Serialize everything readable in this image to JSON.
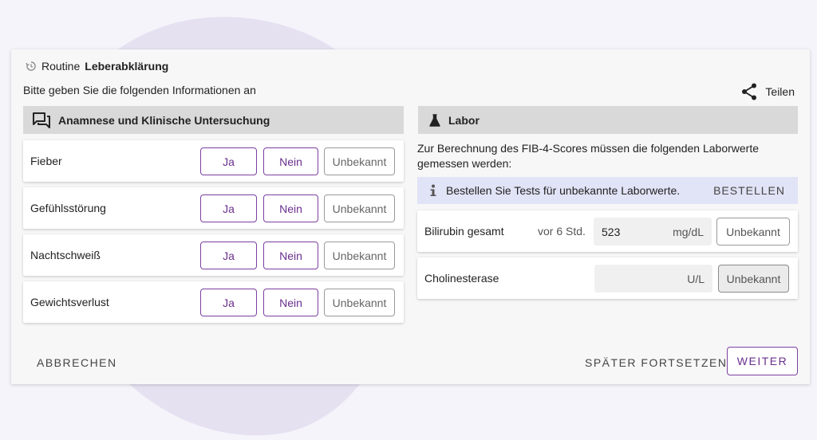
{
  "header": {
    "title_prefix": "Routine",
    "title_bold": "Leberabklärung",
    "subtitle": "Bitte geben Sie die folgenden Informationen an",
    "share_label": "Teilen"
  },
  "anamnese": {
    "heading": "Anamnese und Klinische Untersuchung",
    "questions": [
      {
        "label": "Fieber",
        "yes": "Ja",
        "no": "Nein",
        "unknown": "Unbekannt"
      },
      {
        "label": "Gefühlsstörung",
        "yes": "Ja",
        "no": "Nein",
        "unknown": "Unbekannt"
      },
      {
        "label": "Nachtschweiß",
        "yes": "Ja",
        "no": "Nein",
        "unknown": "Unbekannt"
      },
      {
        "label": "Gewichtsverlust",
        "yes": "Ja",
        "no": "Nein",
        "unknown": "Unbekannt"
      }
    ]
  },
  "labor": {
    "heading": "Labor",
    "intro": "Zur Berechnung des FIB-4-Scores müssen die folgenden Laborwerte gemessen werden:",
    "info_text": "Bestellen Sie Tests für unbekannte Laborwerte.",
    "order_label": "BESTELLEN",
    "tests": [
      {
        "name": "Bilirubin gesamt",
        "time": "vor 6 Std.",
        "value": "523",
        "unit": "mg/dL",
        "unknown": "Unbekannt"
      },
      {
        "name": "Cholinesterase",
        "time": "",
        "value": "",
        "unit": "U/L",
        "unknown": "Unbekannt"
      }
    ]
  },
  "footer": {
    "cancel_label": "ABBRECHEN",
    "later_label": "SPÄTER FORTSETZEN",
    "next_label": "WEITER"
  },
  "colors": {
    "accent": "#6a2f8e",
    "info_bg": "#e1e3f6",
    "section_bg": "#d9d9d9",
    "blob": "#e6e1f1"
  }
}
